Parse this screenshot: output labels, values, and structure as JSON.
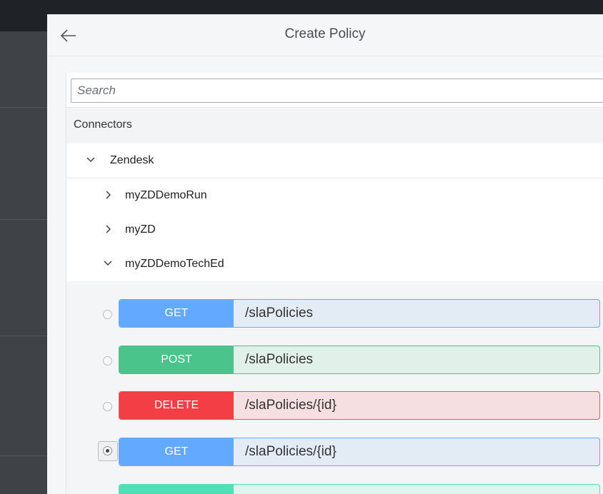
{
  "dialog": {
    "title": "Create Policy"
  },
  "search": {
    "placeholder": "Search",
    "value": ""
  },
  "section": {
    "label": "Connectors"
  },
  "tree": {
    "root": {
      "label": "Zendesk",
      "expanded": true
    },
    "children": [
      {
        "label": "myZDDemoRun",
        "expanded": false
      },
      {
        "label": "myZD",
        "expanded": false
      },
      {
        "label": "myZDDemoTechEd",
        "expanded": true
      }
    ]
  },
  "operations": [
    {
      "method": "GET",
      "path": "/slaPolicies",
      "selected": false
    },
    {
      "method": "POST",
      "path": "/slaPolicies",
      "selected": false
    },
    {
      "method": "DELETE",
      "path": "/slaPolicies/{id}",
      "selected": false
    },
    {
      "method": "GET",
      "path": "/slaPolicies/{id}",
      "selected": true
    }
  ],
  "colors": {
    "get": "#62a9ff",
    "get_bg": "#e3ebf5",
    "post": "#4ac48a",
    "post_bg": "#e1f0e8",
    "delete": "#f33e46",
    "delete_bg": "#f5dfe0",
    "partial_next": "#4fe0b8"
  }
}
